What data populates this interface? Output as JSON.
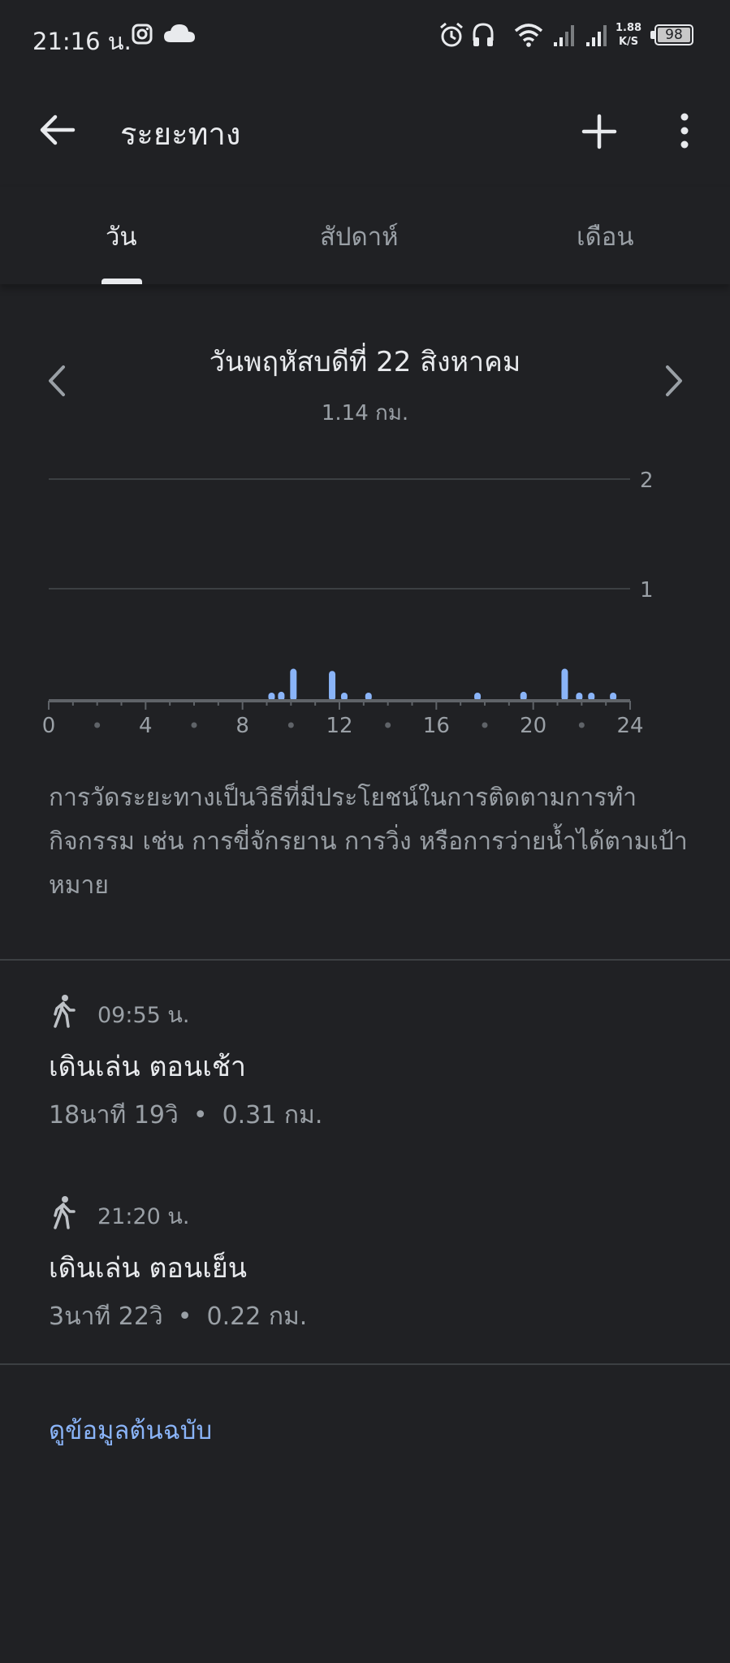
{
  "status_bar": {
    "time": "21:16 น.",
    "speed_value": "1.88",
    "speed_unit": "K/S",
    "battery": "98",
    "icons": [
      "instagram-icon",
      "cloud-icon",
      "alarm-icon",
      "headset-icon",
      "wifi-icon",
      "signal-icon",
      "signal-icon"
    ]
  },
  "app_bar": {
    "title": "ระยะทาง",
    "icons": [
      "back-arrow-icon",
      "add-icon",
      "more-vert-icon"
    ]
  },
  "tabs": [
    {
      "label": "วัน",
      "active": true
    },
    {
      "label": "สัปดาห์",
      "active": false
    },
    {
      "label": "เดือน",
      "active": false
    }
  ],
  "header": {
    "date": "วันพฤหัสบดีที่ 22 สิงหาคม",
    "total": "1.14 กม."
  },
  "chart_data": {
    "type": "bar",
    "x_ticks": [
      "0",
      "4",
      "8",
      "12",
      "16",
      "20",
      "24"
    ],
    "y_ticks": [
      "2",
      "1"
    ],
    "ylim": [
      0,
      2
    ],
    "xlim": [
      0,
      24
    ],
    "color": "#8ab4f8",
    "bars": [
      {
        "x": 9.2,
        "y": 0.02
      },
      {
        "x": 9.6,
        "y": 0.06
      },
      {
        "x": 10.1,
        "y": 0.27
      },
      {
        "x": 11.7,
        "y": 0.25
      },
      {
        "x": 12.2,
        "y": 0.05
      },
      {
        "x": 13.2,
        "y": 0.03
      },
      {
        "x": 17.7,
        "y": 0.01
      },
      {
        "x": 19.6,
        "y": 0.06
      },
      {
        "x": 21.3,
        "y": 0.27
      },
      {
        "x": 21.9,
        "y": 0.03
      },
      {
        "x": 22.4,
        "y": 0.04
      },
      {
        "x": 23.3,
        "y": 0.02
      }
    ]
  },
  "description": "การวัดระยะทางเป็นวิธีที่มีประโยชน์ในการติดตามการทำกิจกรรม เช่น การขี่จักรยาน การวิ่ง หรือการว่ายน้ำได้ตามเป้าหมาย",
  "sessions": [
    {
      "time": "09:55 น.",
      "title": "เดินเล่น ตอนเช้า",
      "duration": "18นาที 19วิ",
      "distance": "0.31 กม.",
      "icon": "walk-icon"
    },
    {
      "time": "21:20 น.",
      "title": "เดินเล่น ตอนเย็น",
      "duration": "3นาที 22วิ",
      "distance": "0.22 กม.",
      "icon": "walk-icon"
    }
  ],
  "footer_link": "ดูข้อมูลต้นฉบับ"
}
